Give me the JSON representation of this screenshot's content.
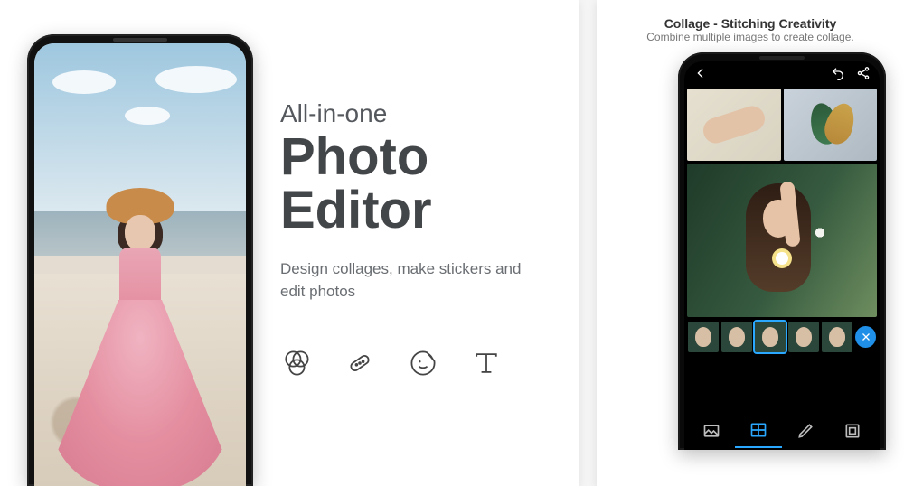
{
  "left": {
    "kicker": "All-in-one",
    "heading": "Photo Editor",
    "subheading": "Design collages, make stickers and edit photos",
    "tools": [
      {
        "name": "looks-icon"
      },
      {
        "name": "heal-icon"
      },
      {
        "name": "sticker-icon"
      },
      {
        "name": "text-icon"
      }
    ]
  },
  "right": {
    "title": "Collage - Stitching Creativity",
    "subtitle": "Combine multiple images to create collage.",
    "toolbar": {
      "back": "back-icon",
      "undo": "undo-icon",
      "share": "share-icon"
    },
    "thumbnails_count": 5,
    "selected_thumbnail_index": 2,
    "delete_button": "delete-icon",
    "bottom_nav": [
      {
        "name": "image-icon",
        "active": false
      },
      {
        "name": "collage-layout-icon",
        "active": true
      },
      {
        "name": "edit-icon",
        "active": false
      },
      {
        "name": "border-icon",
        "active": false
      }
    ]
  },
  "colors": {
    "accent": "#2aa8ff",
    "text_primary": "#434649",
    "text_secondary": "#6a6e72"
  }
}
